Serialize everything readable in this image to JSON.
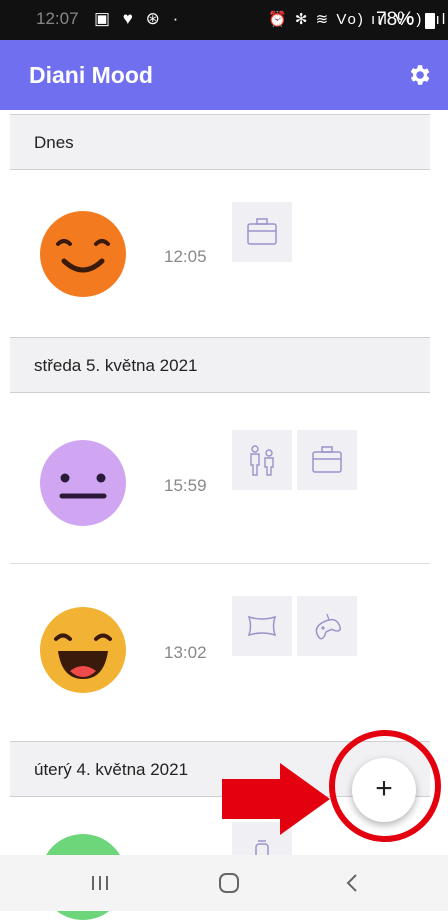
{
  "status_bar": {
    "time": "12:07",
    "left_icons": "▣ ♥ ⊛ ·",
    "right_icons": "⏰ ✻ ≋ Vo) ııl Vo) ııl",
    "battery": "78%"
  },
  "app_bar": {
    "title": "Diani Mood",
    "settings_icon": "gear-icon"
  },
  "sections": [
    {
      "header": "Dnes",
      "entries": [
        {
          "mood": "smiling",
          "mood_color": "#f47a1f",
          "time": "12:05",
          "activities": [
            "briefcase-icon"
          ]
        }
      ]
    },
    {
      "header": "středa 5. května 2021",
      "entries": [
        {
          "mood": "neutral",
          "mood_color": "#d0a6f2",
          "time": "15:59",
          "activities": [
            "meeting-icon",
            "briefcase-icon"
          ]
        },
        {
          "mood": "laughing",
          "mood_color": "#f2b233",
          "time": "13:02",
          "activities": [
            "pillow-icon",
            "gamepad-icon"
          ]
        }
      ]
    },
    {
      "header": "úterý 4. května 2021",
      "entries": [
        {
          "mood": "happy",
          "mood_color": "#6dd67b",
          "time": "",
          "activities": [
            "alarm-icon"
          ]
        }
      ]
    }
  ],
  "fab": {
    "label": "+"
  },
  "annotation": {
    "ring_color": "#e3000f",
    "arrow_color": "#e3000f"
  },
  "nav_bar": {
    "recents": "|||",
    "home": "◯",
    "back": "<"
  },
  "colors": {
    "accent": "#6f6ff0"
  }
}
